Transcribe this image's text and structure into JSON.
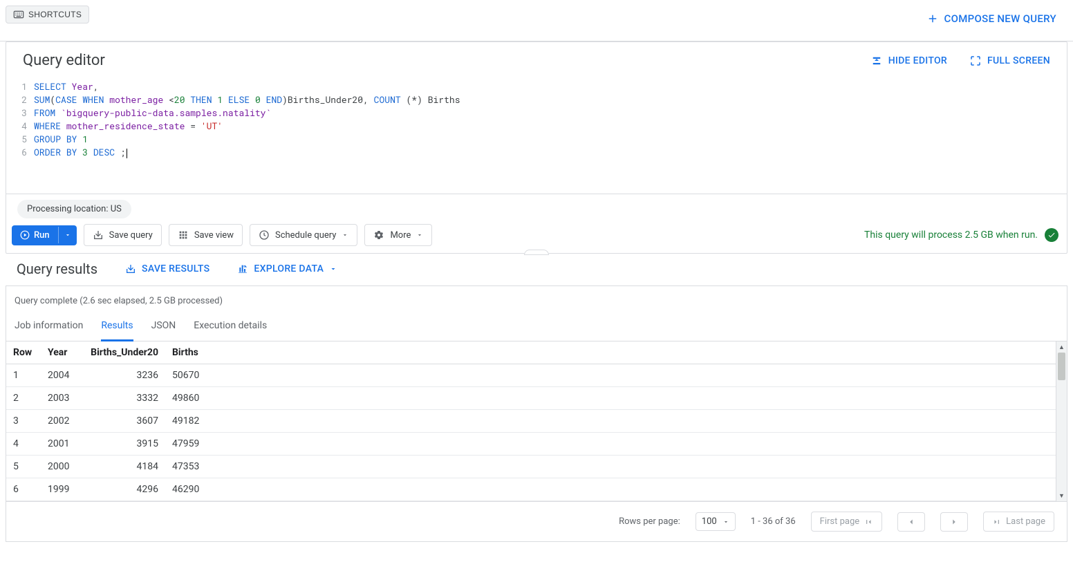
{
  "topbar": {
    "shortcuts_label": "SHORTCUTS",
    "compose_label": "COMPOSE NEW QUERY"
  },
  "editor": {
    "title": "Query editor",
    "hide_label": "HIDE EDITOR",
    "fullscreen_label": "FULL SCREEN",
    "processing_location": "Processing location: US",
    "run_label": "Run",
    "save_query_label": "Save query",
    "save_view_label": "Save view",
    "schedule_label": "Schedule query",
    "more_label": "More",
    "status_text": "This query will process 2.5 GB when run.",
    "code": {
      "l1": {
        "a": "SELECT",
        "b": " Year",
        "c": ","
      },
      "l2": {
        "a": "SUM",
        "b": "(",
        "c": "CASE",
        "d": " ",
        "e": "WHEN",
        "f": " mother_age ",
        "g": "<",
        "h": "20",
        "i": " ",
        "j": "THEN",
        "k": " ",
        "l": "1",
        "m": " ",
        "n": "ELSE",
        "o": " ",
        "p": "0",
        "q": " ",
        "r": "END",
        "s": ")Births_Under20, ",
        "t": "COUNT",
        "u": " (*) Births"
      },
      "l3": {
        "a": "FROM",
        "b": " `bigquery-public-data.samples.natality`"
      },
      "l4": {
        "a": "WHERE",
        "b": " mother_residence_state ",
        "c": "=",
        "d": " ",
        "e": "'UT'"
      },
      "l5": {
        "a": "GROUP",
        "b": " ",
        "c": "BY",
        "d": " ",
        "e": "1"
      },
      "l6": {
        "a": "ORDER",
        "b": " ",
        "c": "BY",
        "d": " ",
        "e": "3",
        "f": " ",
        "g": "DESC",
        "h": " ;"
      }
    }
  },
  "results": {
    "title": "Query results",
    "save_results_label": "SAVE RESULTS",
    "explore_label": "EXPLORE DATA",
    "complete_text": "Query complete (2.6 sec elapsed, 2.5 GB processed)",
    "tabs": {
      "job_info": "Job information",
      "results": "Results",
      "json": "JSON",
      "exec": "Execution details"
    },
    "columns": [
      "Row",
      "Year",
      "Births_Under20",
      "Births"
    ],
    "rows": [
      {
        "row": "1",
        "year": "2004",
        "u20": "3236",
        "births": "50670"
      },
      {
        "row": "2",
        "year": "2003",
        "u20": "3332",
        "births": "49860"
      },
      {
        "row": "3",
        "year": "2002",
        "u20": "3607",
        "births": "49182"
      },
      {
        "row": "4",
        "year": "2001",
        "u20": "3915",
        "births": "47959"
      },
      {
        "row": "5",
        "year": "2000",
        "u20": "4184",
        "births": "47353"
      },
      {
        "row": "6",
        "year": "1999",
        "u20": "4296",
        "births": "46290"
      }
    ],
    "pagination": {
      "rows_per_page_label": "Rows per page:",
      "rows_per_page_value": "100",
      "range": "1 - 36 of 36",
      "first": "First page",
      "last": "Last page"
    }
  }
}
